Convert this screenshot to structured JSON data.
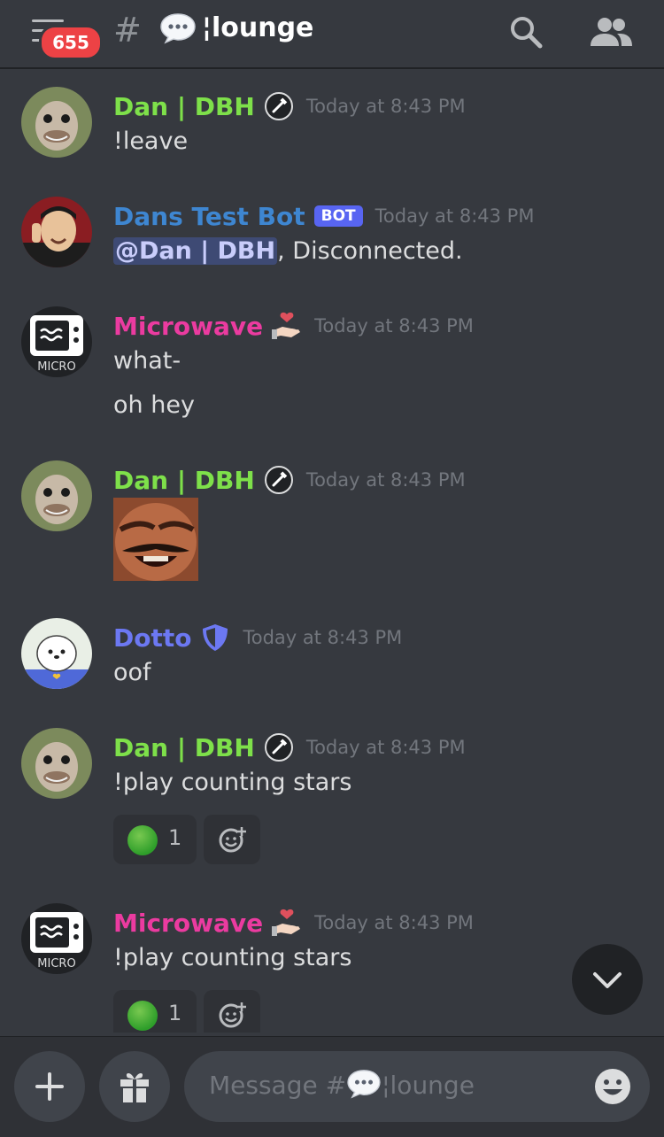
{
  "header": {
    "unread_badge": "655",
    "channel_hash": "#",
    "channel_name": "¦lounge"
  },
  "messages": [
    {
      "username": "Dan | DBH",
      "color": "#7ee04a",
      "timestamp": "Today at 8:43 PM",
      "lines": [
        "!leave"
      ]
    },
    {
      "username": "Dans Test Bot",
      "color": "#3e86d1",
      "badge": "BOT",
      "timestamp": "Today at 8:43 PM",
      "mention": "@Dan | DBH",
      "text_after": ", Disconnected."
    },
    {
      "username": "Microwave",
      "color": "#eb3ba0",
      "timestamp": "Today at 8:43 PM",
      "lines": [
        "what-",
        "oh hey"
      ],
      "avatar_text": "MICRO"
    },
    {
      "username": "Dan | DBH",
      "color": "#7ee04a",
      "timestamp": "Today at 8:43 PM",
      "lines": []
    },
    {
      "username": "Dotto",
      "color": "#6c78f2",
      "timestamp": "Today at 8:43 PM",
      "lines": [
        "oof"
      ]
    },
    {
      "username": "Dan | DBH",
      "color": "#7ee04a",
      "timestamp": "Today at 8:43 PM",
      "lines": [
        "!play counting stars"
      ],
      "reaction_count": "1"
    },
    {
      "username": "Microwave",
      "color": "#eb3ba0",
      "timestamp": "Today at 8:43 PM",
      "lines": [
        "!play counting stars"
      ],
      "reaction_count": "1",
      "avatar_text": "MICRO"
    }
  ],
  "composer": {
    "placeholder_prefix": "Message #",
    "placeholder_channel": "¦lounge"
  },
  "icons": {
    "menu": "hamburger-icon",
    "search": "search-icon",
    "members": "members-icon",
    "add": "plus-icon",
    "gift": "gift-icon",
    "emoji": "emoji-icon",
    "jump": "chevron-down-icon"
  }
}
